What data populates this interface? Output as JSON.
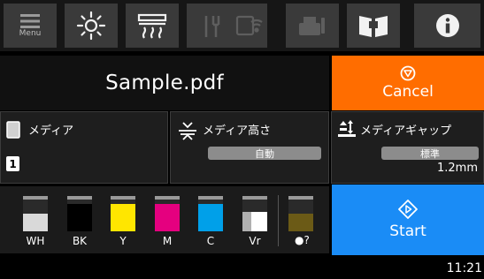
{
  "toolbar": {
    "menu_label": "Menu",
    "icons": [
      "menu-icon",
      "light-icon",
      "heater-icon",
      "maintenance-icon",
      "network-icon",
      "printer-settings-icon",
      "manual-icon",
      "info-icon"
    ]
  },
  "job": {
    "filename": "Sample.pdf",
    "cancel_label": "Cancel"
  },
  "media": {
    "media_label": "メディア",
    "media_number": "1",
    "height_label": "メディア高さ",
    "height_value": "自動",
    "gap_label": "メディアギャップ",
    "gap_value": "標準",
    "gap_measure": "1.2mm"
  },
  "inks": [
    {
      "label": "WH",
      "color": "#d9d9d9",
      "level": 0.55
    },
    {
      "label": "BK",
      "color": "#000000",
      "level": 0.85
    },
    {
      "label": "Y",
      "color": "#ffe600",
      "level": 0.85
    },
    {
      "label": "M",
      "color": "#e5007f",
      "level": 0.85
    },
    {
      "label": "C",
      "color": "#00a0e9",
      "level": 0.85
    },
    {
      "label": "Vr",
      "color": "#ffffff",
      "level": 0.6
    },
    {
      "label": "",
      "color": "#6b5a16",
      "level": 0.55,
      "icon": "waste-ink-icon"
    }
  ],
  "start_label": "Start",
  "clock": "11:21"
}
